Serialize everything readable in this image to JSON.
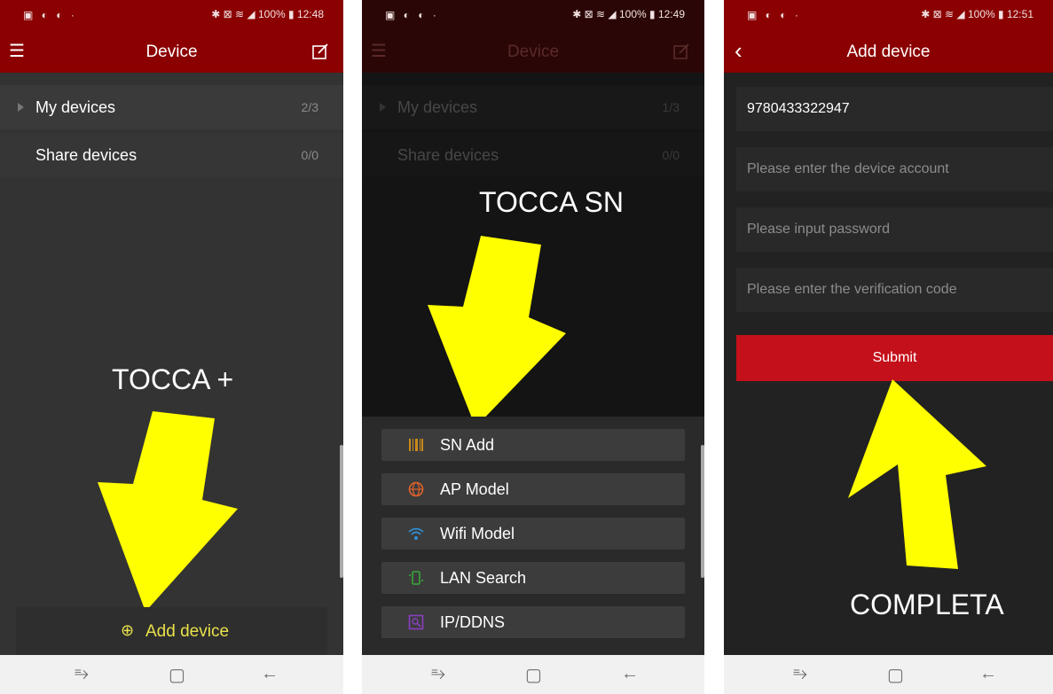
{
  "status_bars": [
    {
      "left_icons": "▣ ◐ ◐ ·",
      "right": "✱ ⊠ ≋ ◢ 100% ▮ 12:48"
    },
    {
      "left_icons": "▣ ◐ ◐ ·",
      "right": "✱ ⊠ ≋ ◢ 100% ▮ 12:49"
    },
    {
      "left_icons": "▣ ◐ ◐ ·",
      "right": "✱ ⊠ ≋ ◢ 100% ▮ 12:51"
    }
  ],
  "screen1": {
    "title": "Device",
    "rows": [
      {
        "label": "My devices",
        "count": "2/3"
      },
      {
        "label": "Share devices",
        "count": "0/0"
      }
    ],
    "overlay": "TOCCA +",
    "add_device": "Add device"
  },
  "screen2": {
    "title": "Device",
    "rows": [
      {
        "label": "My devices",
        "count": "1/3"
      },
      {
        "label": "Share devices",
        "count": "0/0"
      }
    ],
    "overlay": "TOCCA SN",
    "menu": [
      {
        "label": "SN Add",
        "icon": "barcode-icon",
        "color": "#c98a1a"
      },
      {
        "label": "AP Model",
        "icon": "globe-icon",
        "color": "#e0622a"
      },
      {
        "label": "Wifi Model",
        "icon": "wifi-icon",
        "color": "#2f8fd8"
      },
      {
        "label": "LAN Search",
        "icon": "lan-icon",
        "color": "#3aa63a"
      },
      {
        "label": "IP/DDNS",
        "icon": "ip-icon",
        "color": "#8a3fc0"
      }
    ]
  },
  "screen3": {
    "title": "Add device",
    "serial": "9780433322947",
    "account_placeholder": "Please enter the device account",
    "password_placeholder": "Please input password",
    "code_placeholder": "Please enter the verification code",
    "submit": "Submit",
    "overlay": "COMPLETA"
  },
  "colors": {
    "header": "#8b0000",
    "submit": "#c4101b",
    "arrow": "#ffff00"
  }
}
